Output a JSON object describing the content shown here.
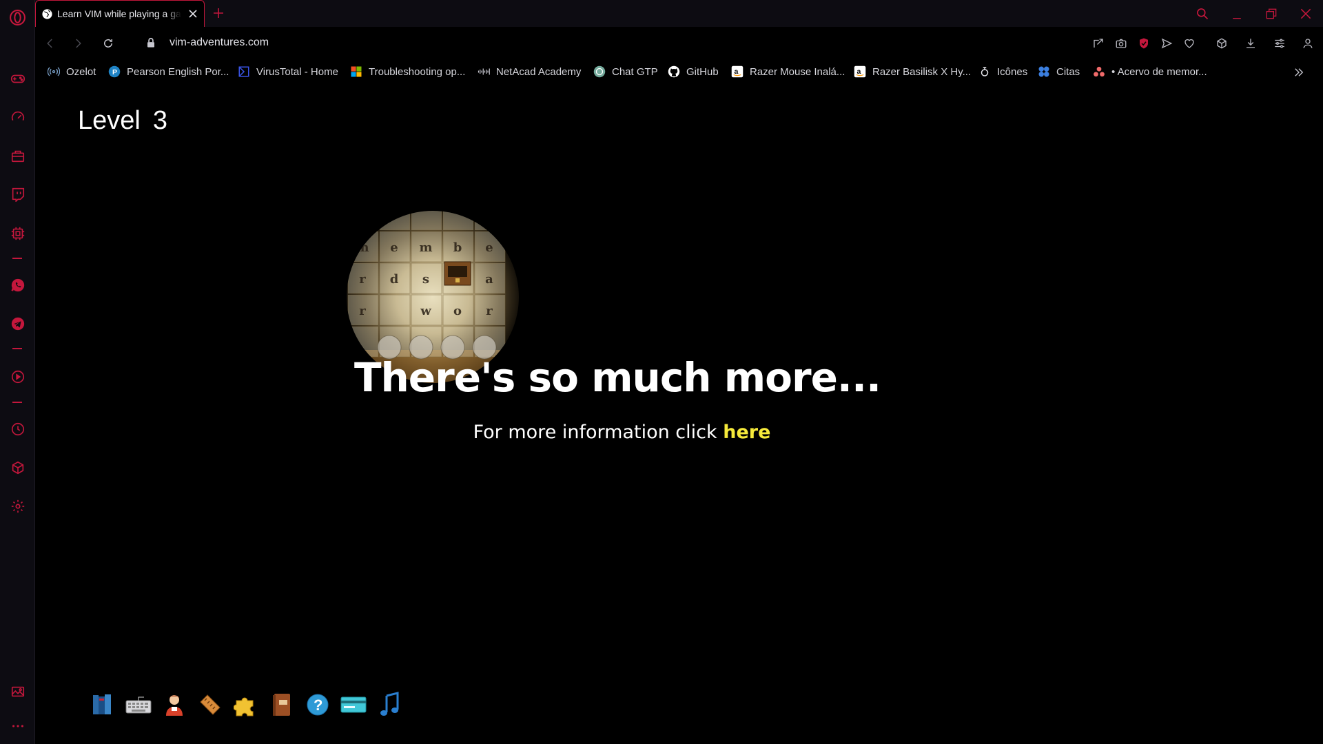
{
  "colors": {
    "accent": "#c4173c",
    "background": "#000000",
    "chrome": "#0d0c12",
    "link_highlight": "#f6ea3b",
    "text": "#ffffff"
  },
  "sidebar": {
    "items": [
      {
        "icon": "opera-logo-icon"
      },
      {
        "icon": "gamepad-icon"
      },
      {
        "icon": "speedometer-icon"
      },
      {
        "icon": "store-icon"
      },
      {
        "icon": "twitch-icon"
      },
      {
        "icon": "cpu-icon"
      },
      {
        "icon": "whatsapp-icon"
      },
      {
        "icon": "telegram-icon"
      },
      {
        "icon": "player-icon"
      },
      {
        "icon": "history-icon"
      },
      {
        "icon": "cube-icon"
      },
      {
        "icon": "settings-icon"
      },
      {
        "icon": "wallpaper-icon"
      },
      {
        "icon": "more-icon"
      }
    ]
  },
  "tabs": [
    {
      "title": "Learn VIM while playing a game",
      "active": true
    }
  ],
  "address_bar": {
    "url": "vim-adventures.com"
  },
  "bookmarks": [
    {
      "label": "Ozelot",
      "icon": "ozelot-icon"
    },
    {
      "label": "Pearson English Por...",
      "icon": "pearson-icon"
    },
    {
      "label": "VirusTotal - Home",
      "icon": "virustotal-icon"
    },
    {
      "label": "Troubleshooting op...",
      "icon": "microsoft-icon"
    },
    {
      "label": "NetAcad Academy",
      "icon": "cisco-icon"
    },
    {
      "label": "Chat GTP",
      "icon": "chatgpt-icon"
    },
    {
      "label": "GitHub",
      "icon": "github-icon"
    },
    {
      "label": "Razer Mouse Inalá...",
      "icon": "amazon-icon"
    },
    {
      "label": "Razer Basilisk X Hy...",
      "icon": "amazon-icon"
    },
    {
      "label": "Icônes",
      "icon": "icones-icon"
    },
    {
      "label": "Citas",
      "icon": "citas-icon"
    },
    {
      "label": "• Acervo de memor...",
      "icon": "asana-icon"
    }
  ],
  "page": {
    "level_label": "Level",
    "level_number": "3",
    "headline": "There's so much more...",
    "info_prefix": "For more information click ",
    "info_link": "here",
    "grid_letters": [
      [
        "m",
        "e",
        "m",
        "b",
        "e"
      ],
      [
        "r",
        "d",
        "s",
        "",
        "a"
      ],
      [
        "r",
        "",
        "w",
        "o",
        "r"
      ]
    ],
    "tray": [
      {
        "icon": "books-icon"
      },
      {
        "icon": "keyboard-icon"
      },
      {
        "icon": "character-icon"
      },
      {
        "icon": "ruler-icon"
      },
      {
        "icon": "puzzle-icon"
      },
      {
        "icon": "book-icon"
      },
      {
        "icon": "help-icon"
      },
      {
        "icon": "card-icon"
      },
      {
        "icon": "music-icon"
      }
    ]
  }
}
